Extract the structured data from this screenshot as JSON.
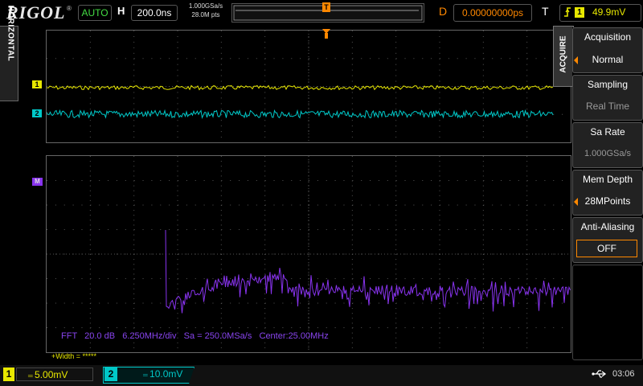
{
  "top": {
    "logo": "RIGOL",
    "logo_mark": "®",
    "run_status": "AUTO",
    "h_label": "H",
    "timebase": "200.0ns",
    "sample_rate": "1.000GSa/s",
    "memory_points": "28.0M pts",
    "delay_label": "D",
    "delay": "0.00000000ps",
    "trigger_label": "T",
    "trigger_slope_icon": "rising-edge-icon",
    "trigger_source": "1",
    "trigger_level": "49.9mV",
    "trigger_position_marker": "T"
  },
  "side_tabs": {
    "horizontal": "HORIZONTAL",
    "acquire": "ACQUIRE"
  },
  "markers": {
    "ch1": "1",
    "ch2": "2",
    "math": "M"
  },
  "fft": {
    "info": "FFT   20.0 dB   6.250MHz/div   Sa = 250.0MSa/s   Center:25.00MHz",
    "width_line": "+Width = *****"
  },
  "menu": {
    "acquisition_label": "Acquisition",
    "acquisition_value": "Normal",
    "sampling_label": "Sampling",
    "sampling_value": "Real Time",
    "sa_rate_label": "Sa Rate",
    "sa_rate_value": "1.000GSa/s",
    "mem_depth_label": "Mem Depth",
    "mem_depth_value": "28MPoints",
    "anti_aliasing_label": "Anti-Aliasing",
    "anti_aliasing_value": "OFF"
  },
  "bottom": {
    "ch1_number": "1",
    "ch1_scale": "5.00mV",
    "ch2_number": "2",
    "ch2_scale": "10.0mV",
    "coupling_symbol": "═",
    "usb_icon": "usb-icon",
    "clock": "03:06"
  },
  "colors": {
    "ch1": "#e8e800",
    "ch2": "#00c8c8",
    "math": "#8833ee",
    "trigger": "#ff8800"
  }
}
